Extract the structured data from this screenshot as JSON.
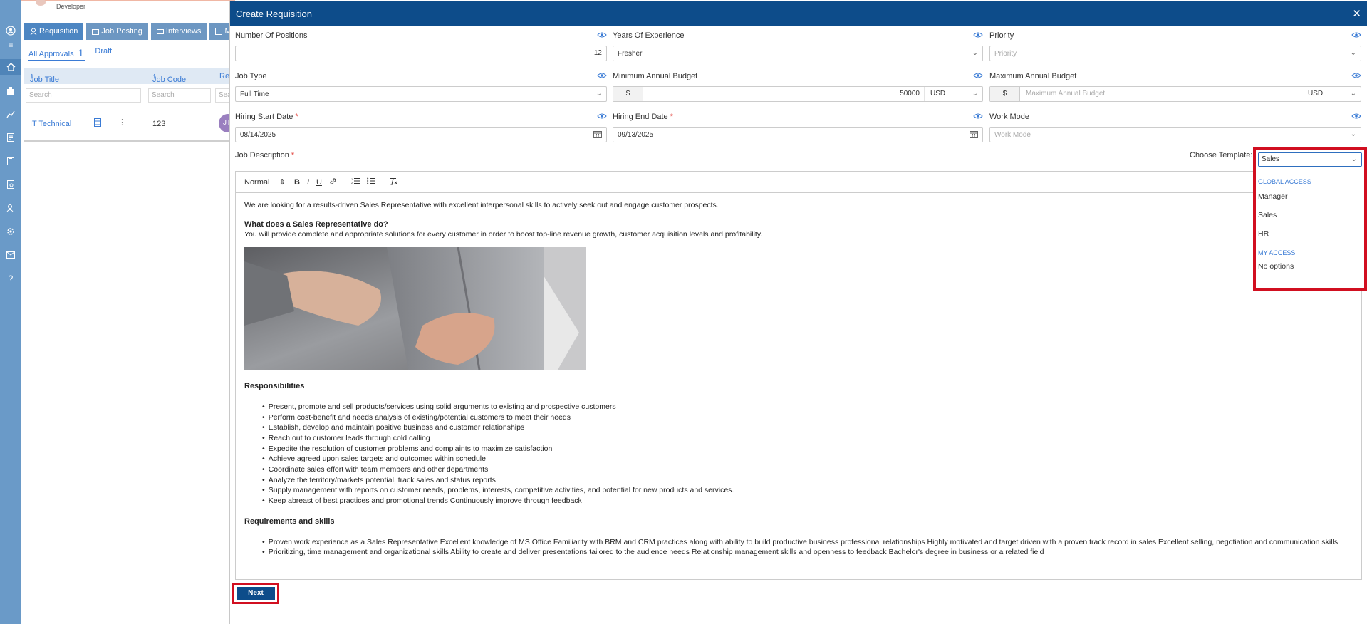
{
  "app": {
    "user_role": "Developer"
  },
  "nav": {
    "tabs": [
      {
        "label": "Requisition"
      },
      {
        "label": "Job Posting"
      },
      {
        "label": "Interviews"
      },
      {
        "label": "M"
      }
    ],
    "subtabs": {
      "all_approvals": "All Approvals",
      "count": "1",
      "draft": "Draft"
    }
  },
  "table": {
    "headers": [
      "Job Title",
      "Job Code",
      "Req"
    ],
    "search_placeholder": "Search",
    "rows": [
      {
        "job_title": "IT Technical",
        "job_code": "123",
        "avatar": "JT"
      }
    ]
  },
  "modal": {
    "title": "Create Requisition",
    "close": "✕",
    "fields": {
      "num_positions": {
        "label": "Number Of Positions",
        "value": "12"
      },
      "experience": {
        "label": "Years Of Experience",
        "value": "Fresher"
      },
      "priority": {
        "label": "Priority",
        "placeholder": "Priority"
      },
      "job_type": {
        "label": "Job Type",
        "value": "Full Time"
      },
      "min_budget": {
        "label": "Minimum Annual Budget",
        "symbol": "$",
        "value": "50000",
        "currency": "USD"
      },
      "max_budget": {
        "label": "Maximum Annual Budget",
        "symbol": "$",
        "placeholder": "Maximum Annual Budget",
        "currency": "USD"
      },
      "start_date": {
        "label": "Hiring Start Date",
        "required": "*",
        "value": "08/14/2025"
      },
      "end_date": {
        "label": "Hiring End Date",
        "required": "*",
        "value": "09/13/2025"
      },
      "work_mode": {
        "label": "Work Mode",
        "placeholder": "Work Mode"
      },
      "description": {
        "label": "Job Description",
        "required": "*"
      }
    },
    "template": {
      "label": "Choose Template:",
      "selected": "Sales",
      "groups": [
        {
          "name": "GLOBAL ACCESS",
          "options": [
            "Manager",
            "Sales",
            "HR"
          ]
        },
        {
          "name": "MY ACCESS",
          "options": []
        }
      ],
      "no_options": "No options"
    },
    "toolbar": {
      "format": "Normal"
    },
    "editor": {
      "intro": "We are looking for a results-driven Sales Representative with excellent interpersonal skills to actively seek out and engage customer prospects.",
      "q_heading": "What does a Sales Representative do?",
      "q_text": "You will provide complete and appropriate solutions for every customer in order to boost top-line revenue growth, customer acquisition levels and profitability.",
      "resp_heading": "Responsibilities",
      "responsibilities": [
        "Present, promote and sell products/services using solid arguments to existing and prospective customers",
        "Perform cost-benefit and needs analysis of existing/potential customers to meet their needs",
        "Establish, develop and maintain positive business and customer relationships",
        "Reach out to customer leads through cold calling",
        "Expedite the resolution of customer problems and complaints to maximize satisfaction",
        "Achieve agreed upon sales targets and outcomes within schedule",
        "Coordinate sales effort with team members and other departments",
        "Analyze the territory/markets potential, track sales and status reports",
        "Supply management with reports on customer needs, problems, interests, competitive activities, and potential for new products and services.",
        "Keep abreast of best practices and promotional trends Continuously improve through feedback"
      ],
      "req_heading": "Requirements and skills",
      "requirements": [
        "Proven work experience as a Sales Representative Excellent knowledge of MS Office Familiarity with BRM and CRM practices along with ability to build productive business professional relationships Highly motivated and target driven with a proven track record in sales Excellent selling, negotiation and communication skills",
        "Prioritizing, time management and organizational skills Ability to create and deliver presentations tailored to the audience needs Relationship management skills and openness to feedback Bachelor's degree in business or a related field"
      ]
    },
    "next_label": "Next"
  },
  "colors": {
    "header": "#0d4c8a",
    "accent": "#3a7bd5",
    "highlight": "#d10f20",
    "rail": "#6a9ac8"
  }
}
